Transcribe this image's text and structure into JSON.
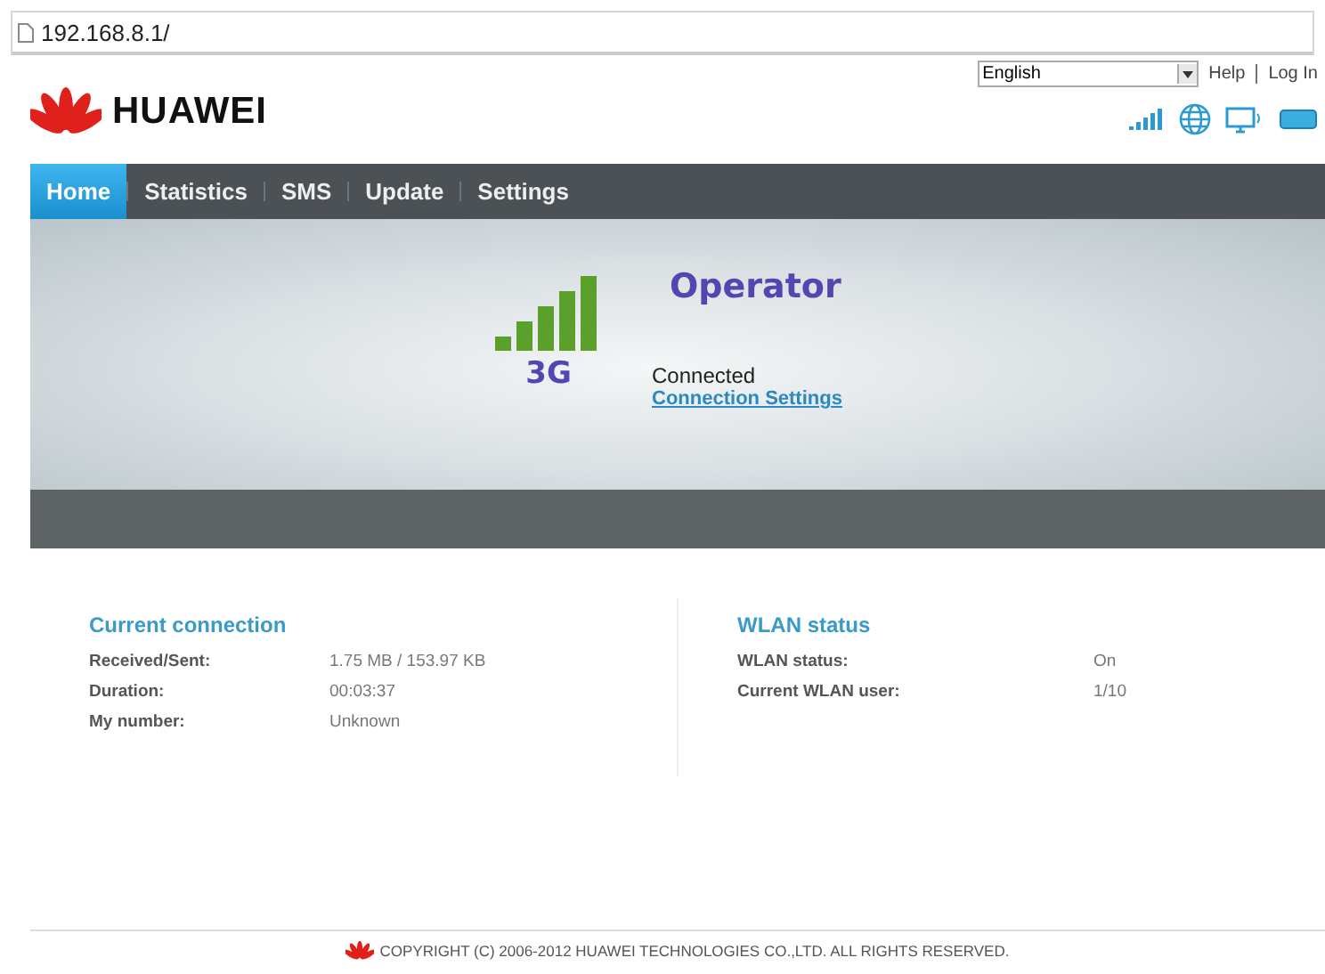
{
  "address_bar": {
    "url": "192.168.8.1/"
  },
  "header": {
    "brand": "HUAWEI",
    "language": "English",
    "links": [
      "Help",
      "Log In"
    ]
  },
  "nav": [
    {
      "label": "Home",
      "selected": true
    },
    {
      "label": "Statistics",
      "selected": false
    },
    {
      "label": "SMS",
      "selected": false
    },
    {
      "label": "Update",
      "selected": false
    },
    {
      "label": "Settings",
      "selected": false
    }
  ],
  "hero": {
    "network": "3G",
    "operator": "Operator",
    "status": "Connected",
    "link": "Connection Settings"
  },
  "sections": [
    {
      "title": "Current connection",
      "rows": [
        {
          "label": "Received/Sent:",
          "value": "1.75 MB / 153.97 KB"
        },
        {
          "label": "Duration:",
          "value": "00:03:37"
        },
        {
          "label": "My number:",
          "value": "Unknown"
        }
      ]
    },
    {
      "title": "WLAN status",
      "rows": [
        {
          "label": "WLAN status:",
          "value": "On"
        },
        {
          "label": "Current WLAN user:",
          "value": "1/10"
        }
      ]
    }
  ],
  "footer": "COPYRIGHT (C) 2006-2012 HUAWEI TECHNOLOGIES CO.,LTD. ALL RIGHTS RESERVED."
}
